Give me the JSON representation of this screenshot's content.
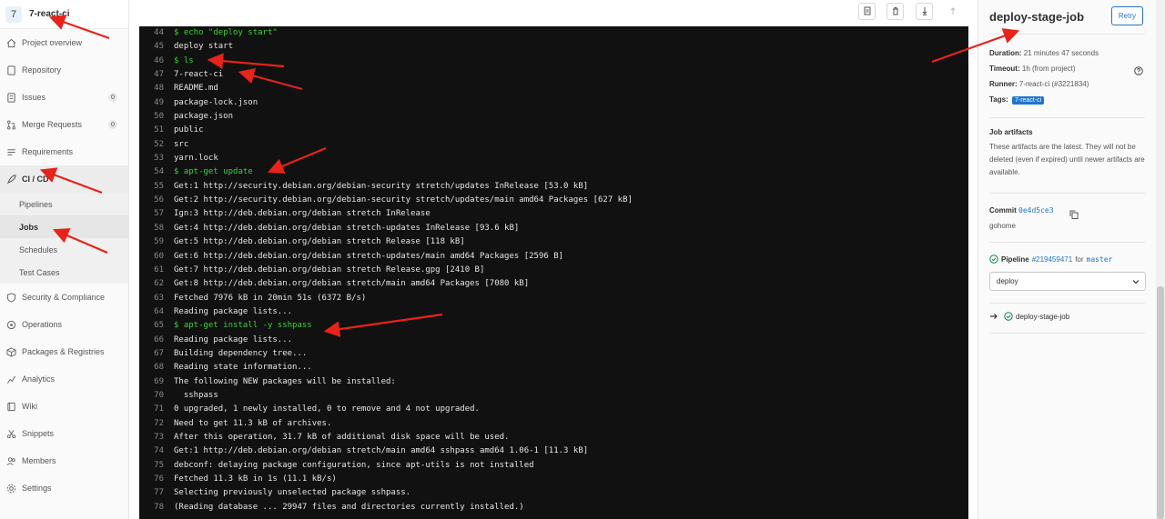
{
  "project": {
    "avatar": "7",
    "name": "7-react-ci"
  },
  "sidebar": {
    "items": [
      {
        "label": "Project overview",
        "icon": "home-icon"
      },
      {
        "label": "Repository",
        "icon": "doc-icon"
      },
      {
        "label": "Issues",
        "icon": "issues-icon",
        "badge": "0"
      },
      {
        "label": "Merge Requests",
        "icon": "merge-icon",
        "badge": "0"
      },
      {
        "label": "Requirements",
        "icon": "list-icon"
      },
      {
        "label": "CI / CD",
        "icon": "rocket-icon"
      }
    ],
    "cicd_sub": [
      "Pipelines",
      "Jobs",
      "Schedules",
      "Test Cases"
    ],
    "items_after": [
      {
        "label": "Security & Compliance",
        "icon": "shield-icon"
      },
      {
        "label": "Operations",
        "icon": "cloud-icon"
      },
      {
        "label": "Packages & Registries",
        "icon": "package-icon"
      },
      {
        "label": "Analytics",
        "icon": "chart-icon"
      },
      {
        "label": "Wiki",
        "icon": "book-icon"
      },
      {
        "label": "Snippets",
        "icon": "scissors-icon"
      },
      {
        "label": "Members",
        "icon": "users-icon"
      },
      {
        "label": "Settings",
        "icon": "gear-icon"
      }
    ]
  },
  "toolbar": {
    "icons": [
      "raw-log-icon",
      "erase-icon",
      "scroll-bottom-icon",
      "scroll-top-icon"
    ]
  },
  "log": [
    {
      "n": "44",
      "t": "$ echo \"deploy start\"",
      "cmd": true
    },
    {
      "n": "45",
      "t": "deploy start"
    },
    {
      "n": "46",
      "t": "$ ls",
      "cmd": true
    },
    {
      "n": "47",
      "t": "7-react-ci"
    },
    {
      "n": "48",
      "t": "README.md"
    },
    {
      "n": "49",
      "t": "package-lock.json"
    },
    {
      "n": "50",
      "t": "package.json"
    },
    {
      "n": "51",
      "t": "public"
    },
    {
      "n": "52",
      "t": "src"
    },
    {
      "n": "53",
      "t": "yarn.lock"
    },
    {
      "n": "54",
      "t": "$ apt-get update",
      "cmd": true
    },
    {
      "n": "55",
      "t": "Get:1 http://security.debian.org/debian-security stretch/updates InRelease [53.0 kB]"
    },
    {
      "n": "56",
      "t": "Get:2 http://security.debian.org/debian-security stretch/updates/main amd64 Packages [627 kB]"
    },
    {
      "n": "57",
      "t": "Ign:3 http://deb.debian.org/debian stretch InRelease"
    },
    {
      "n": "58",
      "t": "Get:4 http://deb.debian.org/debian stretch-updates InRelease [93.6 kB]"
    },
    {
      "n": "59",
      "t": "Get:5 http://deb.debian.org/debian stretch Release [118 kB]"
    },
    {
      "n": "60",
      "t": "Get:6 http://deb.debian.org/debian stretch-updates/main amd64 Packages [2596 B]"
    },
    {
      "n": "61",
      "t": "Get:7 http://deb.debian.org/debian stretch Release.gpg [2410 B]"
    },
    {
      "n": "62",
      "t": "Get:8 http://deb.debian.org/debian stretch/main amd64 Packages [7080 kB]"
    },
    {
      "n": "63",
      "t": "Fetched 7976 kB in 20min 51s (6372 B/s)"
    },
    {
      "n": "64",
      "t": "Reading package lists..."
    },
    {
      "n": "65",
      "t": "$ apt-get install -y sshpass",
      "cmd": true
    },
    {
      "n": "66",
      "t": "Reading package lists..."
    },
    {
      "n": "67",
      "t": "Building dependency tree..."
    },
    {
      "n": "68",
      "t": "Reading state information..."
    },
    {
      "n": "69",
      "t": "The following NEW packages will be installed:"
    },
    {
      "n": "70",
      "t": "  sshpass"
    },
    {
      "n": "71",
      "t": "0 upgraded, 1 newly installed, 0 to remove and 4 not upgraded."
    },
    {
      "n": "72",
      "t": "Need to get 11.3 kB of archives."
    },
    {
      "n": "73",
      "t": "After this operation, 31.7 kB of additional disk space will be used."
    },
    {
      "n": "74",
      "t": "Get:1 http://deb.debian.org/debian stretch/main amd64 sshpass amd64 1.06-1 [11.3 kB]"
    },
    {
      "n": "75",
      "t": "debconf: delaying package configuration, since apt-utils is not installed"
    },
    {
      "n": "76",
      "t": "Fetched 11.3 kB in 1s (11.1 kB/s)"
    },
    {
      "n": "77",
      "t": "Selecting previously unselected package sshpass."
    },
    {
      "n": "78",
      "t": "(Reading database ... 29947 files and directories currently installed.)"
    }
  ],
  "job": {
    "title": "deploy-stage-job",
    "retry": "Retry",
    "duration_label": "Duration:",
    "duration": "21 minutes 47 seconds",
    "timeout_label": "Timeout:",
    "timeout": "1h (from project)",
    "runner_label": "Runner:",
    "runner": "7-react-ci (#3221834)",
    "tags_label": "Tags:",
    "tag": "7-react-ci",
    "artifacts_title": "Job artifacts",
    "artifacts_text": "These artifacts are the latest. They will not be deleted (even if expired) until newer artifacts are available.",
    "commit_label": "Commit",
    "commit_hash": "0e4d5ce3",
    "commit_message": "gohome",
    "pipeline_label": "Pipeline",
    "pipeline_id": "#219459471",
    "pipeline_for": "for",
    "pipeline_branch": "master",
    "stage_selected": "deploy",
    "stage_job": "deploy-stage-job"
  },
  "colors": {
    "accent": "#1f75cb",
    "success": "#108548",
    "terminal_bg": "#111111",
    "command_green": "#3ecf3e",
    "annotation_red": "#e8231a"
  }
}
